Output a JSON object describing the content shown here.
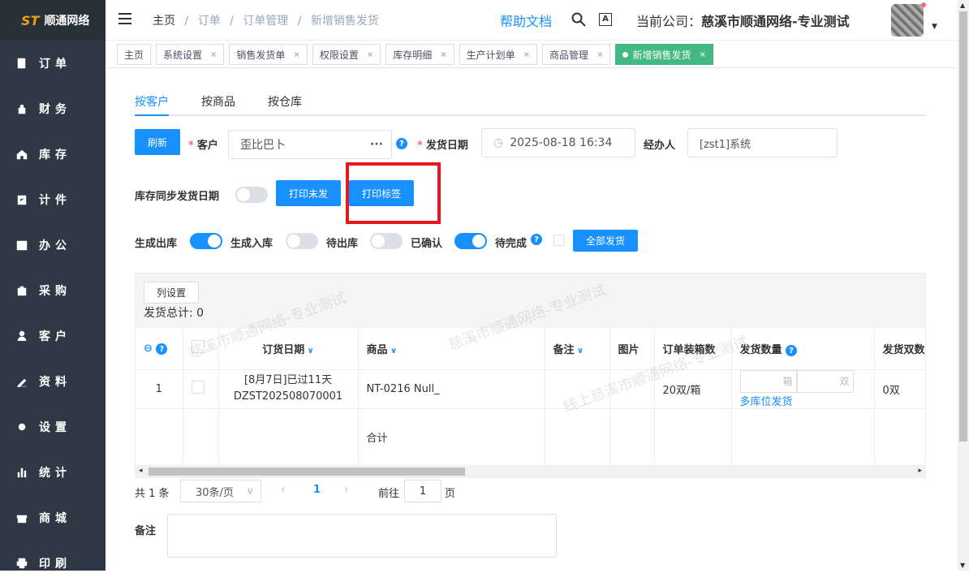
{
  "sidebar": {
    "logo": "顺通网络",
    "items": [
      {
        "label": "订单",
        "icon": "order-icon"
      },
      {
        "label": "财务",
        "icon": "lock-icon"
      },
      {
        "label": "库存",
        "icon": "home-icon"
      },
      {
        "label": "计件",
        "icon": "clipboard-icon"
      },
      {
        "label": "办公",
        "icon": "calendar-icon"
      },
      {
        "label": "采购",
        "icon": "bag-icon"
      },
      {
        "label": "客户",
        "icon": "user-icon"
      },
      {
        "label": "资料",
        "icon": "pen-icon"
      },
      {
        "label": "设置",
        "icon": "gear-icon"
      },
      {
        "label": "统计",
        "icon": "bar-chart-icon"
      },
      {
        "label": "商城",
        "icon": "shop-icon"
      },
      {
        "label": "印刷",
        "icon": "printer-icon"
      }
    ]
  },
  "header": {
    "breadcrumb": [
      "主页",
      "订单",
      "订单管理",
      "新增销售发货"
    ],
    "help": "帮助文档",
    "company_label": "当前公司：",
    "company": "慈溪市顺通网络-专业测试"
  },
  "tabs": [
    {
      "label": "主页",
      "close": ""
    },
    {
      "label": "系统设置",
      "close": "×"
    },
    {
      "label": "销售发货单",
      "close": "×"
    },
    {
      "label": "权限设置",
      "close": "×"
    },
    {
      "label": "库存明细",
      "close": "×"
    },
    {
      "label": "生产计划单",
      "close": "×"
    },
    {
      "label": "商品管理",
      "close": "×"
    },
    {
      "label": "新增销售发货",
      "close": "×"
    }
  ],
  "subtabs": [
    "按客户",
    "按商品",
    "按仓库"
  ],
  "form": {
    "refresh": "刷新",
    "customer_label": "客户",
    "customer_value": "歪比巴卜",
    "date_label": "发货日期",
    "date_value": "2025-08-18 16:34",
    "handler_label": "经办人",
    "handler_value": "[zst1]系统",
    "sync_label": "库存同步发货日期",
    "print_unsent": "打印未发",
    "print_label": "打印标签"
  },
  "toggles": {
    "gen_out": "生成出库",
    "gen_in": "生成入库",
    "pending_out": "待出库",
    "confirmed": "已确认",
    "pending_done": "待完成",
    "ship_all": "全部发货"
  },
  "grid": {
    "col_settings": "列设置",
    "total": "发货总计: 0",
    "headers": [
      "",
      "",
      "订货日期",
      "商品",
      "备注",
      "图片",
      "订单装箱数",
      "发货数量",
      "发货双数"
    ],
    "row": {
      "index": "1",
      "date_line1": "[8月7日]已过11天",
      "date_line2": "DZST202508070001",
      "product": "NT-0216 Null_",
      "box": "20双/箱",
      "unit_box": "箱",
      "unit_pair": "双",
      "multi": "多库位发货",
      "pairs": "0双"
    },
    "sum_label": "合计",
    "watermark": "慈溪市顺通网络-专业测试",
    "watermark2": "线上慈溪市顺通网络-专业测试"
  },
  "pager": {
    "total": "共 1 条",
    "size": "30条/页",
    "page": "1",
    "goto": "前往",
    "goto_value": "1",
    "page_unit": "页"
  },
  "remarks_label": "备注",
  "colors": {
    "accent": "#1890ff",
    "highlight": "#e8171c",
    "sidebar": "#2f3845"
  }
}
